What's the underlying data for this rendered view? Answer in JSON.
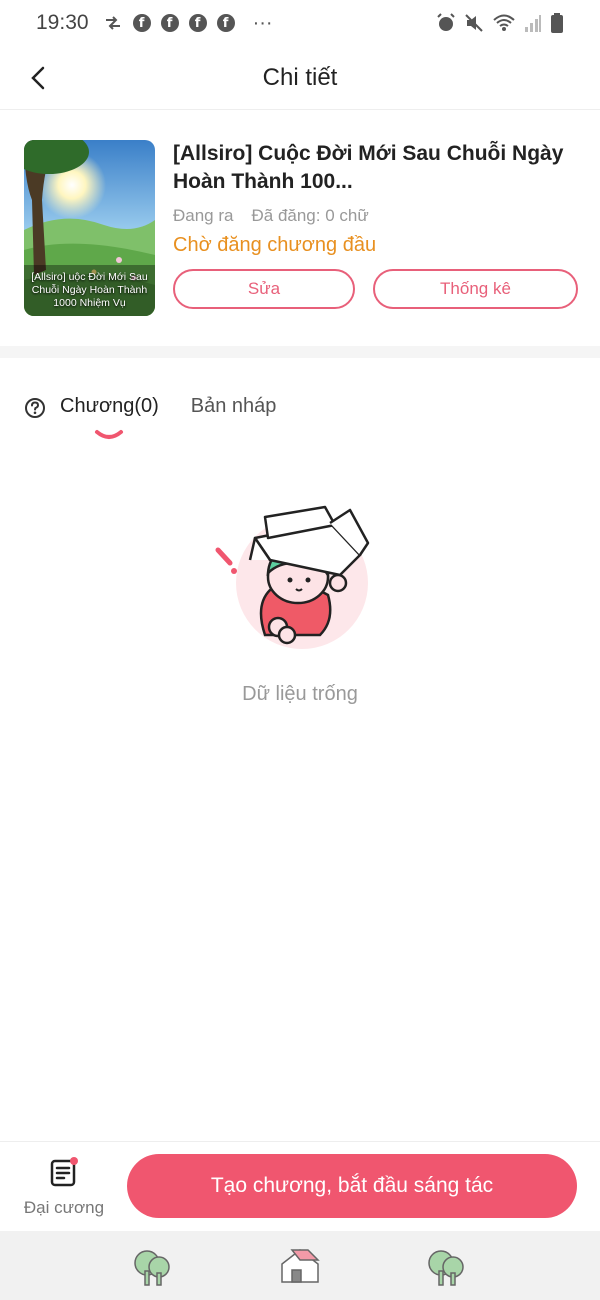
{
  "status_bar": {
    "time": "19:30",
    "dots": "···",
    "app_icons": [
      "swap-icon",
      "facebook-icon",
      "facebook-icon",
      "facebook-icon",
      "facebook-icon"
    ],
    "system_icons": [
      "alarm-icon",
      "mute-icon",
      "wifi-icon",
      "signal-icon",
      "battery-icon"
    ]
  },
  "header": {
    "title": "Chi tiết",
    "back_icon": "chevron-left-icon"
  },
  "book": {
    "title": "[Allsiro] Cuộc Đời Mới Sau Chuỗi Ngày Hoàn Thành 100...",
    "cover_text": "[Allsiro] uộc Đời Mới Sau Chuỗi Ngày Hoàn Thành 1000 Nhiệm Vụ",
    "status_label": "Đang ra",
    "posted_label": "Đã đăng: 0 chữ",
    "publish_status": "Chờ đăng chương đầu",
    "edit_label": "Sửa",
    "stats_label": "Thống kê"
  },
  "tabs": {
    "help_icon": "question-circle-icon",
    "chapter_label": "Chương(0)",
    "draft_label": "Bản nháp"
  },
  "empty_state": {
    "text": "Dữ liệu trống"
  },
  "bottom_actions": {
    "outline_label": "Đại cương",
    "create_label": "Tạo chương, bắt đầu sáng tác"
  },
  "nav": {
    "items": [
      "tree-icon",
      "home-icon",
      "tree-icon"
    ]
  },
  "colors": {
    "accent": "#f0566f",
    "outline_accent": "#e8607a",
    "warning": "#e89020"
  }
}
